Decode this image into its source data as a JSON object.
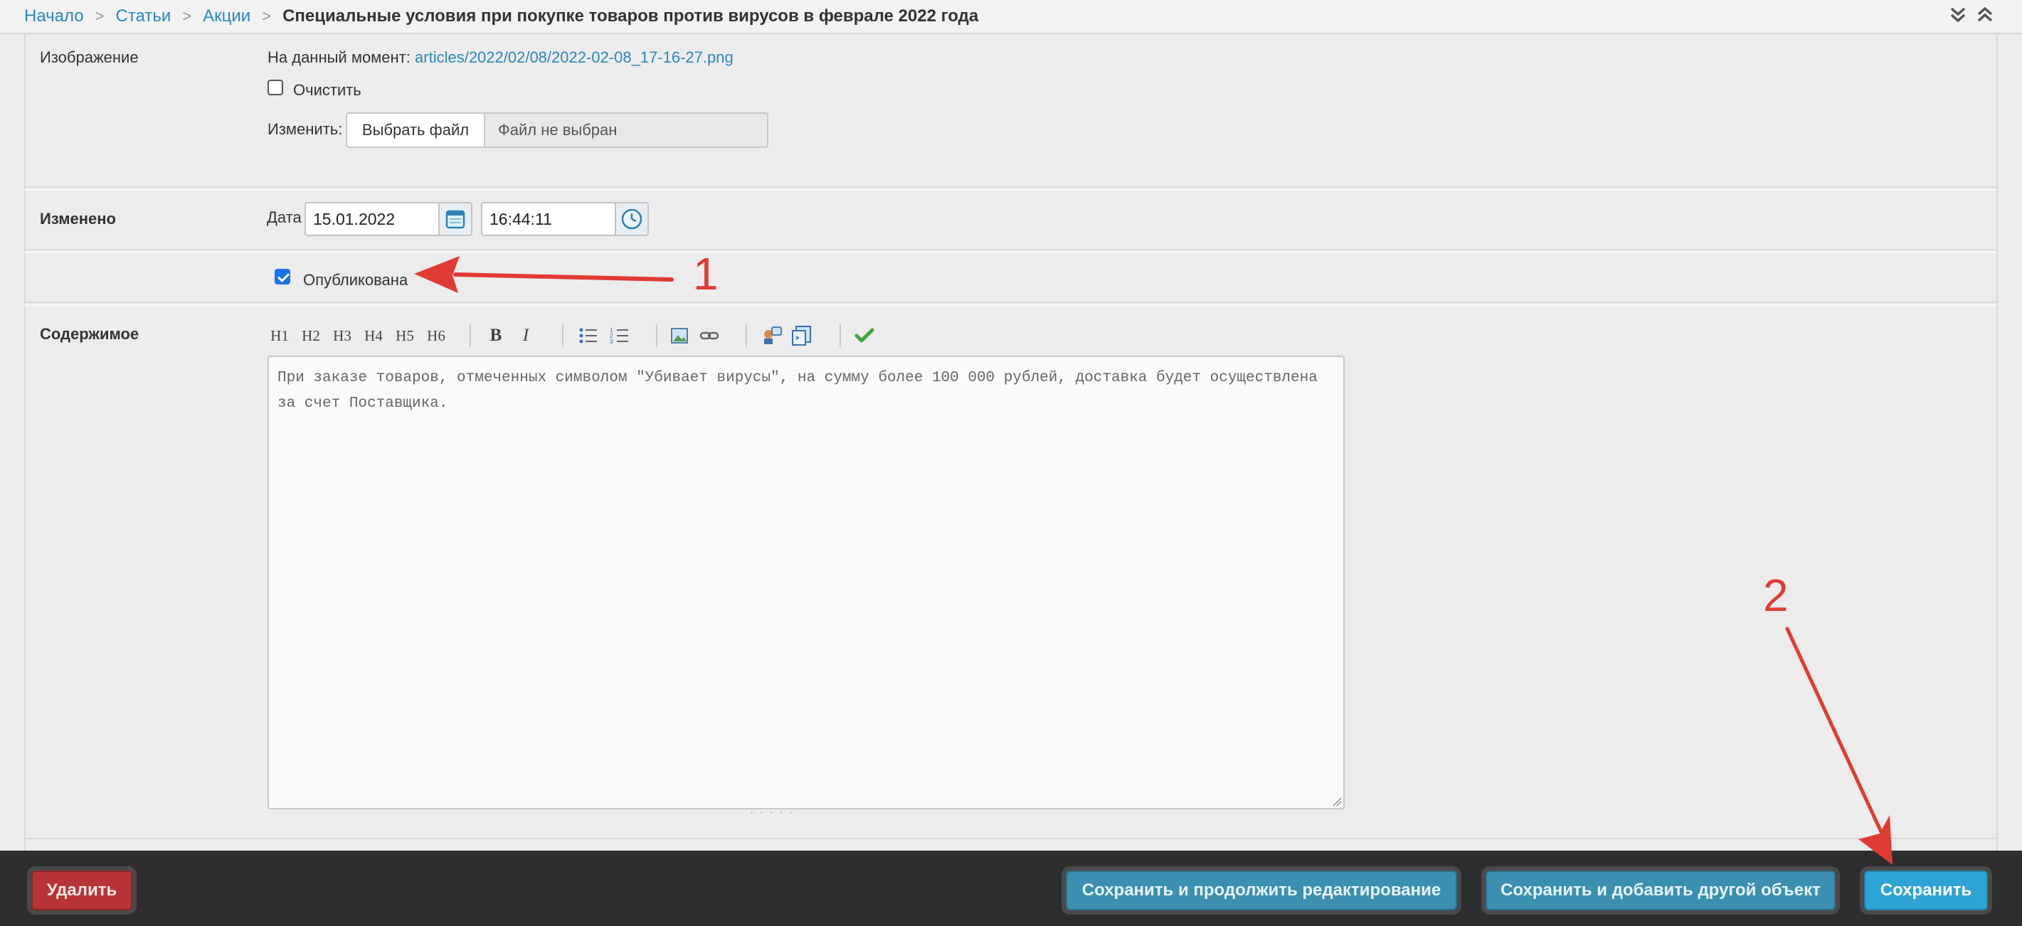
{
  "breadcrumb": {
    "items": [
      "Начало",
      "Статьи",
      "Акции"
    ],
    "current": "Специальные условия при покупке товаров против вирусов в феврале 2022 года"
  },
  "image_field": {
    "label": "Изображение",
    "current_prefix": "На данный момент:",
    "current_file": "articles/2022/02/08/2022-02-08_17-16-27.png",
    "clear_label": "Очистить",
    "clear_checked": false,
    "change_label": "Изменить:",
    "choose_button": "Выбрать файл",
    "no_file": "Файл не выбран"
  },
  "modified_field": {
    "label": "Изменено",
    "date_label": "Дата",
    "date_value": "15.01.2022",
    "time_value": "16:44:11"
  },
  "published_field": {
    "label": "Опубликована",
    "checked": true
  },
  "content_field": {
    "label": "Содержимое",
    "toolbar": [
      "H1",
      "H2",
      "H3",
      "H4",
      "H5",
      "H6",
      "B",
      "I"
    ],
    "text": "При заказе товаров, отмеченных символом \"Убивает вирусы\", на сумму более 100 000 рублей, доставка будет осуществлена за счет Поставщика."
  },
  "footer": {
    "delete_label": "Удалить",
    "save_continue_label": "Сохранить и продолжить редактирование",
    "save_add_label": "Сохранить и добавить другой объект",
    "save_label": "Сохранить"
  },
  "annotations": {
    "marker_1": "1",
    "marker_2": "2",
    "color": "#e03b33"
  },
  "colors": {
    "link": "#2a89b5",
    "save_button": "#2fa3d6",
    "delete_button": "#b63436",
    "footer_bg": "#2e2e2e"
  }
}
